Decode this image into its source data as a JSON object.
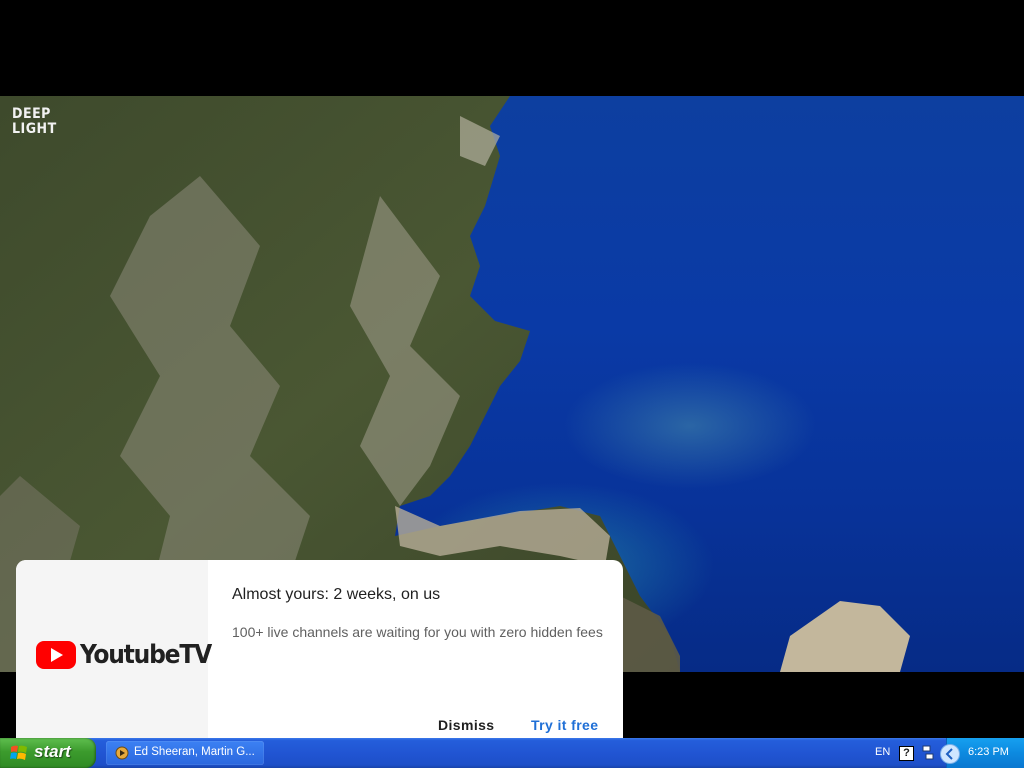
{
  "video": {
    "watermark_line1": "DEEP",
    "watermark_line2": "LIGHT"
  },
  "promo": {
    "brand_logo_text": "YoutubeTV",
    "title": "Almost yours: 2 weeks, on us",
    "subtitle": "100+ live channels are waiting for you with zero hidden fees",
    "dismiss_label": "Dismiss",
    "try_label": "Try it free",
    "accent_color": "#1f6fd6",
    "brand_red": "#ff0000"
  },
  "taskbar": {
    "start_label": "start",
    "task_label": "Ed Sheeran, Martin G...",
    "language": "EN",
    "help_glyph": "?",
    "clock": "6:23 PM"
  }
}
